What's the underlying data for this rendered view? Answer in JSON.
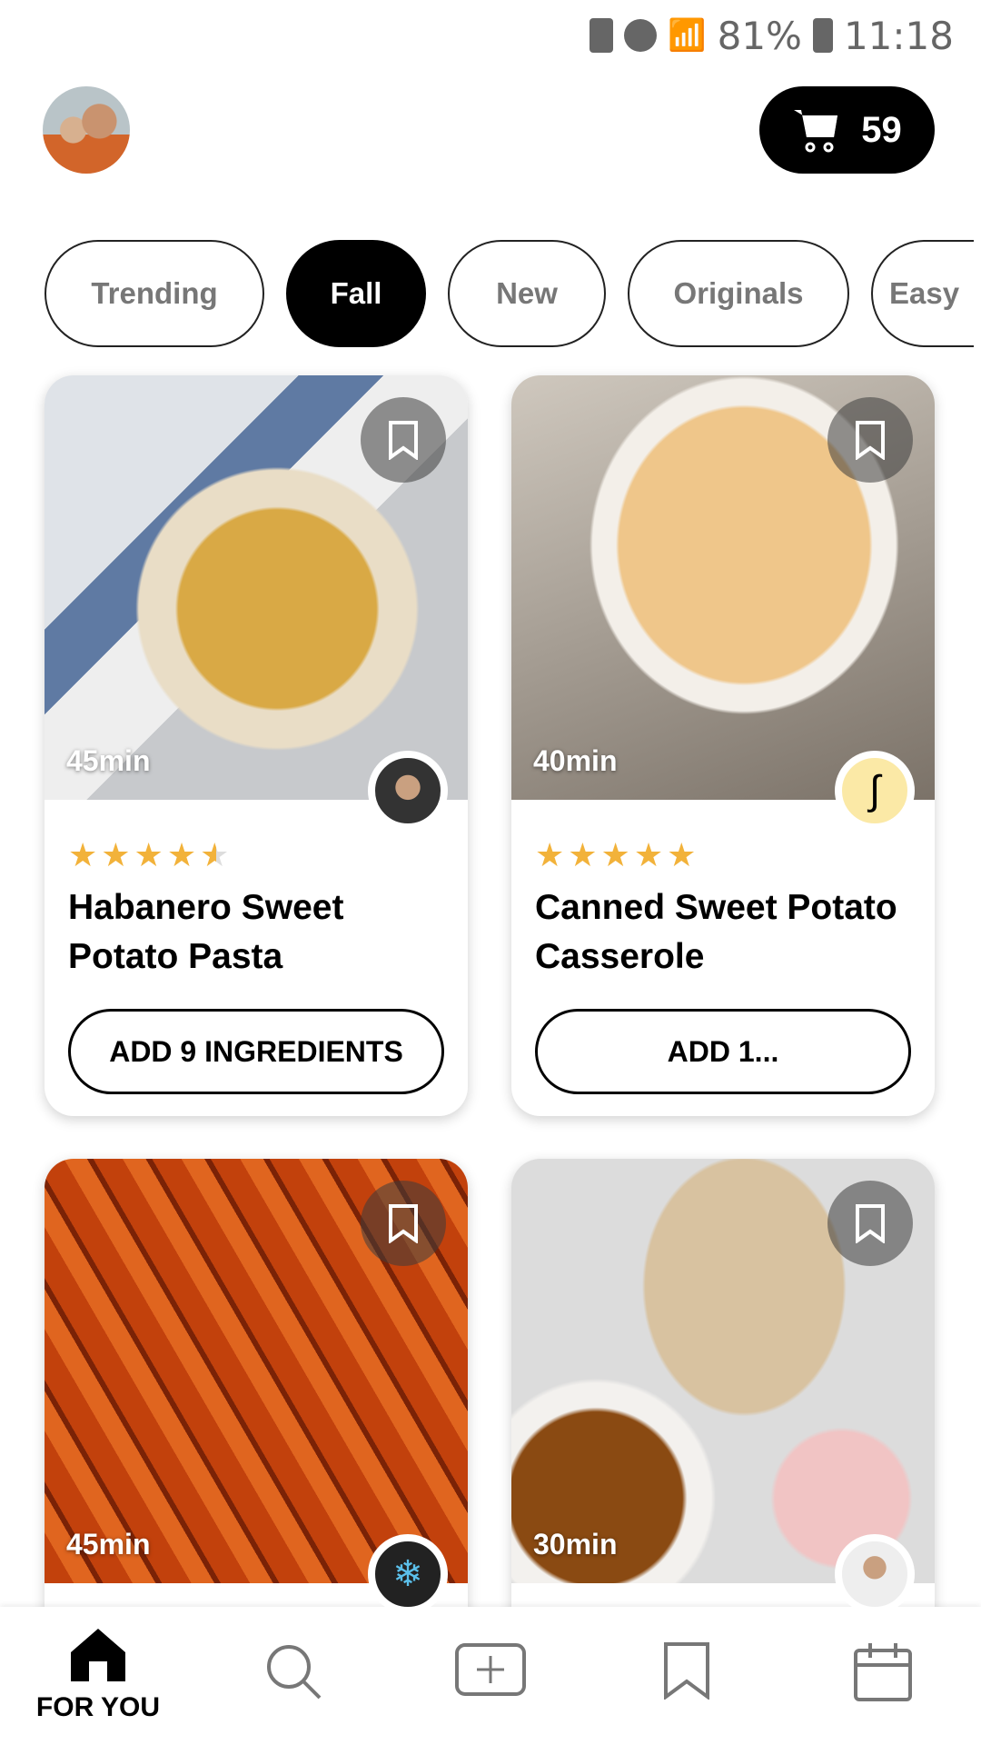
{
  "status_bar": {
    "battery": "81%",
    "time": "11:18"
  },
  "header": {
    "cart_count": "59"
  },
  "chips": [
    {
      "label": "Trending",
      "active": false
    },
    {
      "label": "Fall",
      "active": true
    },
    {
      "label": "New",
      "active": false
    },
    {
      "label": "Originals",
      "active": false
    },
    {
      "label": "Easy",
      "active": false
    }
  ],
  "recipes": [
    {
      "time": "45min",
      "rating": 4.5,
      "stars": "★★★★",
      "half": "★",
      "title": "Habanero Sweet Potato Pasta",
      "button": "ADD 9 INGREDIENTS"
    },
    {
      "time": "40min",
      "rating": 5,
      "stars": "★★★★★",
      "half": "",
      "title": "Canned Sweet Potato Casserole",
      "button": "ADD 1..."
    },
    {
      "time": "45min"
    },
    {
      "time": "30min"
    }
  ],
  "bottom_nav": {
    "active_label": "FOR YOU",
    "items": [
      "home-icon",
      "search-icon",
      "add-icon",
      "bookmark-icon",
      "calendar-icon"
    ]
  },
  "colors": {
    "star": "#f2b23a",
    "accent": "#000000"
  }
}
